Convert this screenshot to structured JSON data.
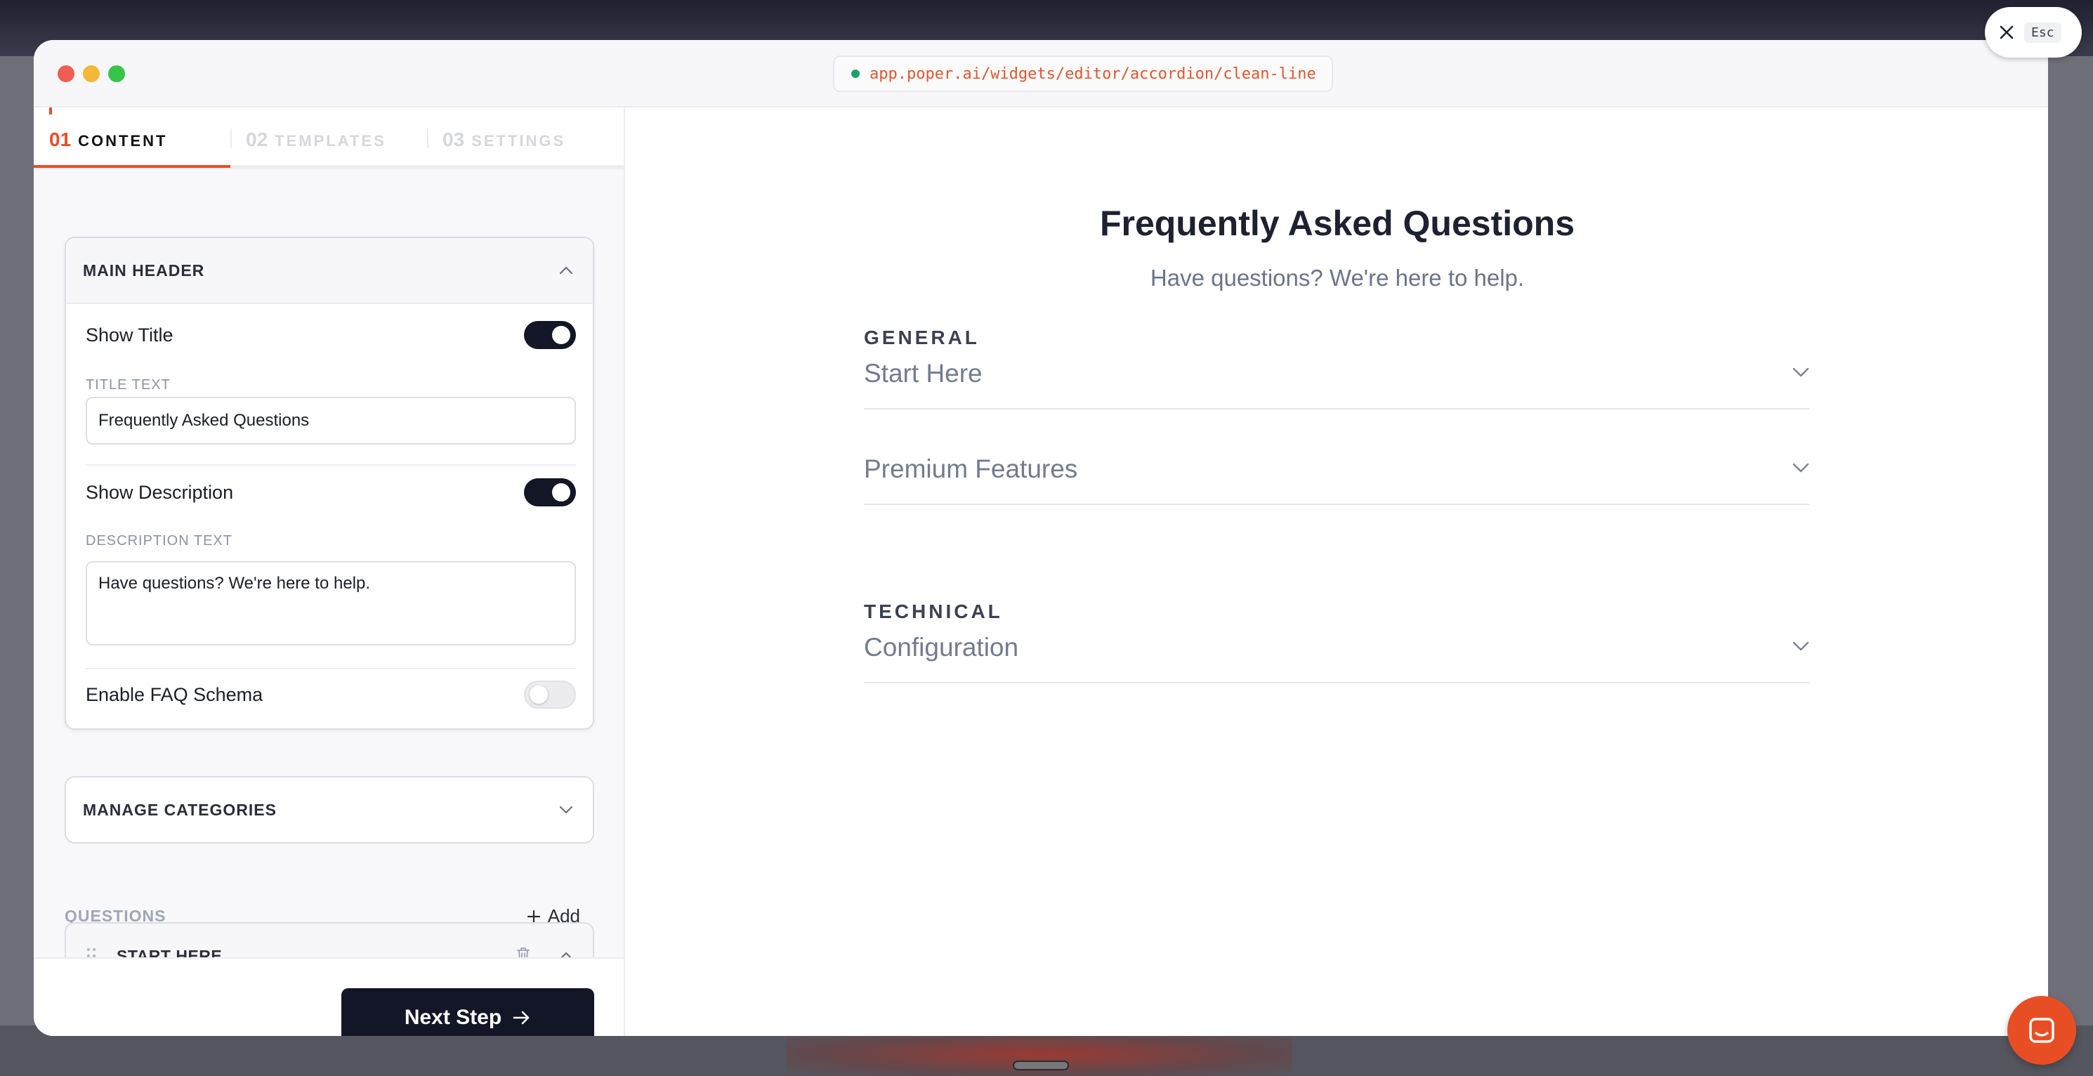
{
  "browser": {
    "url": "app.poper.ai/widgets/editor/accordion/clean-line",
    "close_hint": "Esc"
  },
  "tabs": [
    {
      "num": "01",
      "label": "CONTENT"
    },
    {
      "num": "02",
      "label": "TEMPLATES"
    },
    {
      "num": "03",
      "label": "SETTINGS"
    }
  ],
  "main_header": {
    "title": "MAIN HEADER",
    "show_title_label": "Show Title",
    "show_title": true,
    "title_text_label": "TITLE TEXT",
    "title_text_value": "Frequently Asked Questions",
    "show_description_label": "Show Description",
    "show_description": true,
    "description_text_label": "DESCRIPTION TEXT",
    "description_text_value": "Have questions? We're here to help.",
    "faq_schema_label": "Enable FAQ Schema",
    "faq_schema": false
  },
  "manage_categories": {
    "title": "MANAGE CATEGORIES"
  },
  "questions": {
    "label": "QUESTIONS",
    "add_label": "Add",
    "items": [
      {
        "title": "START HERE"
      }
    ]
  },
  "footer": {
    "next_label": "Next Step"
  },
  "preview": {
    "title": "Frequently Asked Questions",
    "description": "Have questions? We're here to help.",
    "categories": [
      {
        "name": "GENERAL",
        "items": [
          "Start Here",
          "Premium Features"
        ]
      },
      {
        "name": "TECHNICAL",
        "items": [
          "Configuration"
        ]
      }
    ]
  },
  "colors": {
    "accent": "#e84e24",
    "dark": "#121626"
  }
}
